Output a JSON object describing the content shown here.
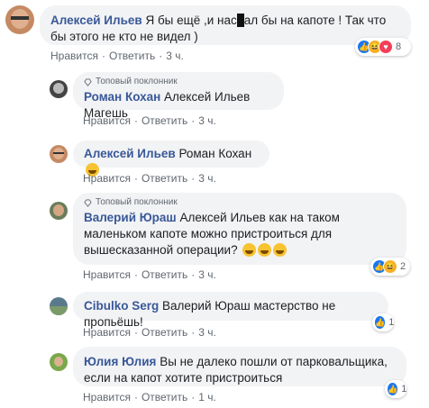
{
  "labels": {
    "like": "Нравится",
    "reply": "Ответить",
    "dot": "·"
  },
  "badge": "Топовый поклонник",
  "comments": [
    {
      "author": "Алексей Ильев",
      "text_a": "Я бы ещё ,и нас",
      "text_b": "ал бы на капоте ! Так что бы этого не кто не видел )",
      "time": "3 ч.",
      "reactions": {
        "icons": [
          "like-icon",
          "haha-icon",
          "love-icon"
        ],
        "count": "8"
      }
    },
    {
      "author": "Роман Кохан",
      "text": "Алексей Ильев Магешь",
      "time": "3 ч.",
      "top_fan": true
    },
    {
      "author": "Алексей Ильев",
      "text": "Роман Кохан",
      "emoji": "grinning-emoji",
      "time": "3 ч."
    },
    {
      "author": "Валерий Юраш",
      "text": "Алексей Ильев как на таком маленьком капоте можно пристроиться для вышесказанной операции?",
      "emoji_count": 3,
      "time": "3 ч.",
      "top_fan": true,
      "reactions": {
        "icons": [
          "like-icon",
          "haha-icon"
        ],
        "count": "2"
      }
    },
    {
      "author": "Cibulko Serg",
      "text": "Валерий Юраш мастерство не пропьёшь!",
      "time": "3 ч.",
      "reactions": {
        "icons": [
          "like-icon"
        ],
        "count": "1"
      }
    },
    {
      "author": "Юлия Юлия",
      "text": "Вы не далеко пошли от парковальщика, если на капот хотите пристроиться",
      "time": "1 ч.",
      "reactions": {
        "icons": [
          "like-icon"
        ],
        "count": "1"
      }
    }
  ]
}
